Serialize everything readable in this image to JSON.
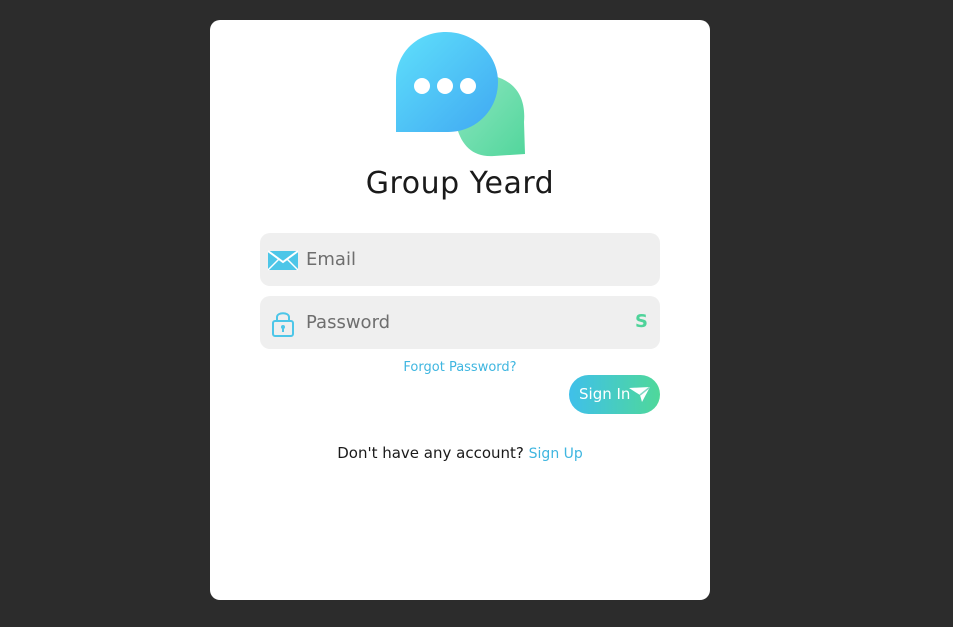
{
  "app": {
    "title": "Group Yeard",
    "logo_icon": "chat-bubbles-icon"
  },
  "form": {
    "email": {
      "placeholder": "Email",
      "value": "",
      "icon": "envelope-icon"
    },
    "password": {
      "placeholder": "Password",
      "value": "",
      "icon": "lock-icon",
      "toggle_label": "S"
    },
    "forgot_label": "Forgot Password?",
    "submit_label": "Sign In",
    "submit_icon": "send-arrow-icon"
  },
  "footer": {
    "prompt": "Don't have any account?",
    "link_label": "Sign Up"
  },
  "colors": {
    "background": "#2c2c2c",
    "card": "#ffffff",
    "accent_blue": "#3fb6e0",
    "accent_green": "#4fd39a",
    "field_bg": "#efefef"
  }
}
